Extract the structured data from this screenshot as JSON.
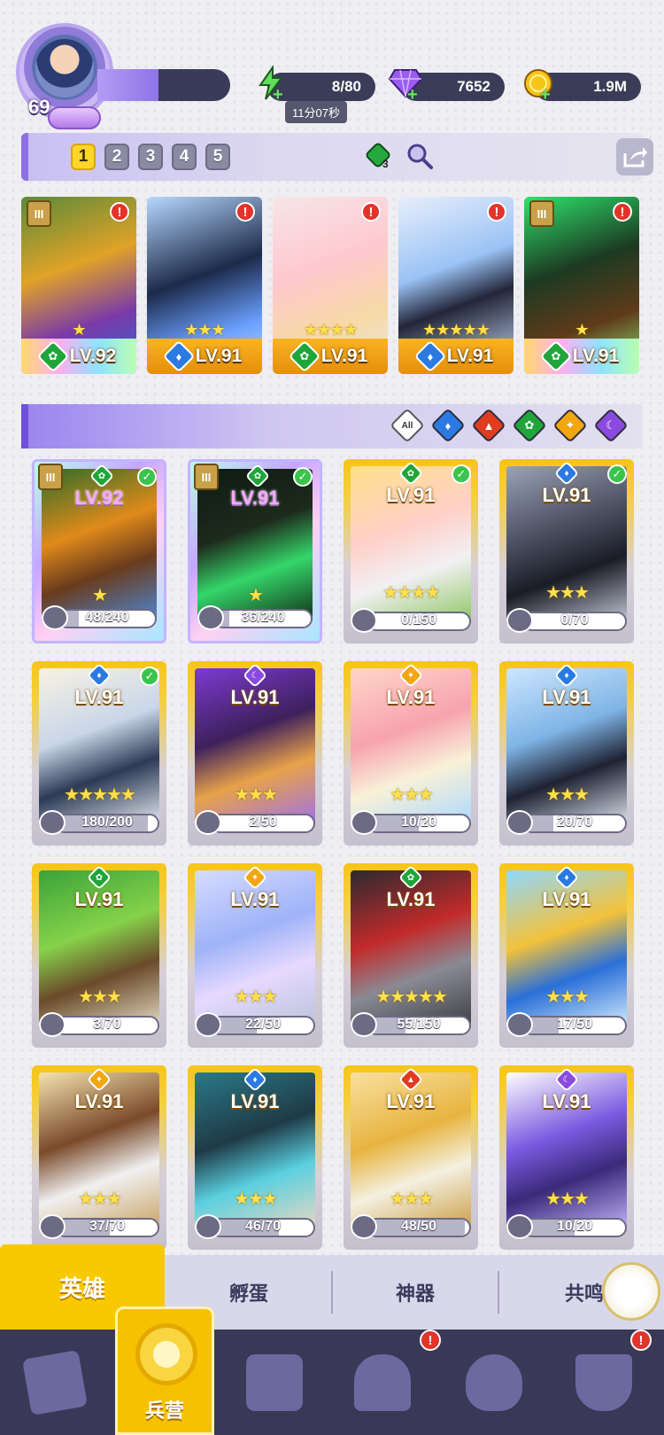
{
  "player": {
    "level": "69"
  },
  "resources": {
    "energy": {
      "value": "8/80",
      "timer": "11分07秒",
      "color": "#6ee26a",
      "icon": "lightning-icon"
    },
    "gems": {
      "value": "7652",
      "color": "#8a4ae0",
      "icon": "gem-icon"
    },
    "gold": {
      "value": "1.9M",
      "color": "#f5c100",
      "icon": "coin-icon"
    }
  },
  "team": {
    "tabs": [
      "1",
      "2",
      "3",
      "4",
      "5"
    ],
    "active_tab": "1",
    "gem_count": "3",
    "members": [
      {
        "lv": "LV.92",
        "element": "nature",
        "tier": "III",
        "stars": "★",
        "alert": "!",
        "bar": "rainbow",
        "art": "linear-gradient(160deg,#5a8a3a,#e0a227 40%,#7a3aa8 70%,#2d6ad8)"
      },
      {
        "lv": "LV.91",
        "element": "water",
        "tier": "",
        "stars": "★★★",
        "alert": "!",
        "bar": "orange",
        "art": "linear-gradient(160deg,#b7d8ff,#1c2a4a 45%,#6aa0ff 75%,#c8d6e6)"
      },
      {
        "lv": "LV.91",
        "element": "nature",
        "tier": "",
        "stars": "★★★★",
        "alert": "!",
        "bar": "orange",
        "art": "linear-gradient(160deg,#f6e6e8,#ffc8cf 40%,#f7d9a6 70%,#e8e8e8)"
      },
      {
        "lv": "LV.91",
        "element": "water",
        "tier": "",
        "stars": "★★★★★",
        "alert": "!",
        "bar": "orange",
        "art": "linear-gradient(160deg,#e8eefb,#9bc3f5 40%,#23263a 60%,#cfe2ff)"
      },
      {
        "lv": "LV.91",
        "element": "nature",
        "tier": "III",
        "stars": "★",
        "alert": "!",
        "bar": "rainbow",
        "art": "linear-gradient(160deg,#2ee36b,#1c3a22 40%,#5f3a1a 70%,#8df07a)"
      }
    ]
  },
  "filters": [
    {
      "name": "all",
      "label": "All"
    },
    {
      "name": "water",
      "label": ""
    },
    {
      "name": "fire",
      "label": ""
    },
    {
      "name": "nature",
      "label": ""
    },
    {
      "name": "light",
      "label": ""
    },
    {
      "name": "dark",
      "label": ""
    }
  ],
  "heroes": [
    {
      "lv": "LV.92",
      "element": "nature",
      "check": true,
      "tier": "III",
      "rainbow": true,
      "stars": "★",
      "shards": "48/240",
      "progress": 0.2,
      "art": "linear-gradient(160deg,#2f6d2a,#e08a1a 40%,#6a3b1c 65%,#4c8ad8)"
    },
    {
      "lv": "LV.91",
      "element": "nature",
      "check": true,
      "tier": "III",
      "rainbow": true,
      "stars": "★",
      "shards": "36/240",
      "progress": 0.15,
      "art": "linear-gradient(160deg,#0d1a12,#1d2b1c 40%,#35d66a 65%,#0f2a14)"
    },
    {
      "lv": "LV.91",
      "element": "nature",
      "check": true,
      "tier": "",
      "rainbow": false,
      "stars": "★★★★",
      "shards": "0/150",
      "progress": 0,
      "art": "linear-gradient(160deg,#ffe08a,#ffd0c8 40%,#f2f0f4 65%,#88c55a)"
    },
    {
      "lv": "LV.91",
      "element": "water",
      "check": true,
      "tier": "",
      "rainbow": false,
      "stars": "★★★",
      "shards": "0/70",
      "progress": 0,
      "art": "linear-gradient(160deg,#9aa2b4,#4a4f60 40%,#1a1c26 65%,#cbd0de)"
    },
    {
      "lv": "LV.91",
      "element": "water",
      "check": true,
      "tier": "",
      "rainbow": false,
      "stars": "★★★★★",
      "shards": "180/200",
      "progress": 0.9,
      "art": "linear-gradient(160deg,#f8f2e4,#c9d6e8 40%,#2c3a56 65%,#eef2f8)"
    },
    {
      "lv": "LV.91",
      "element": "dark",
      "check": false,
      "tier": "",
      "rainbow": false,
      "stars": "★★★",
      "shards": "2/50",
      "progress": 0.04,
      "art": "linear-gradient(160deg,#7e3ad2,#3d205c 40%,#e8a24a 65%,#9b6ef0)"
    },
    {
      "lv": "LV.91",
      "element": "light",
      "check": false,
      "tier": "",
      "rainbow": false,
      "stars": "★★★",
      "shards": "10/20",
      "progress": 0.5,
      "art": "linear-gradient(160deg,#ffd6c8,#f7a3b0 40%,#f9f1d8 65%,#a8d8ff)"
    },
    {
      "lv": "LV.91",
      "element": "water",
      "check": false,
      "tier": "",
      "rainbow": false,
      "stars": "★★★",
      "shards": "20/70",
      "progress": 0.29,
      "art": "linear-gradient(160deg,#cde6ff,#7fb4e6 40%,#1e2232 65%,#e6eef8)"
    },
    {
      "lv": "LV.91",
      "element": "nature",
      "check": false,
      "tier": "",
      "rainbow": false,
      "stars": "★★★",
      "shards": "3/70",
      "progress": 0.04,
      "art": "linear-gradient(160deg,#3aa33a,#86d24a 40%,#6a4a2a 65%,#e8e0c8)"
    },
    {
      "lv": "LV.91",
      "element": "light",
      "check": false,
      "tier": "",
      "rainbow": false,
      "stars": "★★★",
      "shards": "22/50",
      "progress": 0.44,
      "art": "linear-gradient(160deg,#d6dcff,#9fb3f8 40%,#e6d9ff 65%,#b8c2d8)"
    },
    {
      "lv": "LV.91",
      "element": "nature",
      "check": false,
      "tier": "",
      "rainbow": false,
      "stars": "★★★★★",
      "shards": "55/150",
      "progress": 0.37,
      "art": "linear-gradient(160deg,#2a2a30,#c22a2a 40%,#8a8a94 65%,#3a3a42)"
    },
    {
      "lv": "LV.91",
      "element": "water",
      "check": false,
      "tier": "",
      "rainbow": false,
      "stars": "★★★",
      "shards": "17/50",
      "progress": 0.34,
      "art": "linear-gradient(160deg,#8fd8ff,#f3c23a 40%,#2a6fd8 65%,#d8f0ff)"
    },
    {
      "lv": "LV.91",
      "element": "light",
      "check": false,
      "tier": "",
      "rainbow": false,
      "stars": "★★★",
      "shards": "37/70",
      "progress": 0.53,
      "art": "linear-gradient(160deg,#f5e3b0,#7a4a2a 40%,#f0f0f0 65%,#c8a060)"
    },
    {
      "lv": "LV.91",
      "element": "water",
      "check": false,
      "tier": "",
      "rainbow": false,
      "stars": "★★★",
      "shards": "46/70",
      "progress": 0.66,
      "art": "linear-gradient(160deg,#2a7a8a,#1f3a46 40%,#5ad0e0 65%,#f0d8c0)"
    },
    {
      "lv": "LV.91",
      "element": "fire",
      "check": false,
      "tier": "",
      "rainbow": false,
      "stars": "★★★",
      "shards": "48/50",
      "progress": 0.96,
      "art": "linear-gradient(160deg,#f8e0a0,#e8b440 40%,#f4f0e0 65%,#c89a40)"
    },
    {
      "lv": "LV.91",
      "element": "dark",
      "check": false,
      "tier": "",
      "rainbow": false,
      "stars": "★★★",
      "shards": "10/20",
      "progress": 0.5,
      "art": "linear-gradient(160deg,#ffffff,#7a5ae0 40%,#3a2a7a 65%,#c8b8ff)"
    }
  ],
  "tabs": {
    "heroes": "英雄",
    "hatch": "孵蛋",
    "artifacts": "神器",
    "resonance": "共鸣"
  },
  "nav": {
    "barracks": "兵营"
  }
}
